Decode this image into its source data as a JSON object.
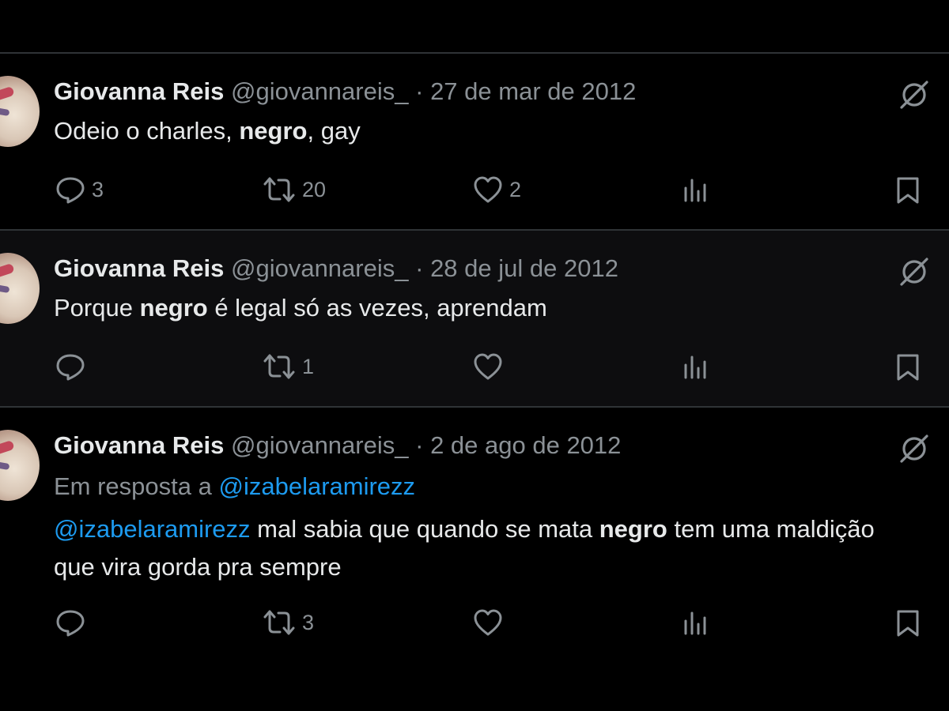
{
  "tweets": [
    {
      "name": "Giovanna Reis",
      "handle": "@giovannareis_",
      "dot": "·",
      "date": "27 de mar de 2012",
      "text": {
        "a": "Odeio o charles, ",
        "b": "negro",
        "c": ", gay"
      },
      "reply_count": "3",
      "retweet_count": "20",
      "like_count": "2"
    },
    {
      "name": "Giovanna Reis",
      "handle": "@giovannareis_",
      "dot": "·",
      "date": "28 de jul de 2012",
      "text": {
        "a": "Porque ",
        "b": "negro",
        "c": " é legal só as vezes, aprendam"
      },
      "reply_count": "",
      "retweet_count": "1",
      "like_count": ""
    },
    {
      "name": "Giovanna Reis",
      "handle": "@giovannareis_",
      "dot": "·",
      "date": "2 de ago de 2012",
      "reply_to": {
        "prefix": "Em resposta a ",
        "mention": "@izabelaramirezz"
      },
      "text": {
        "mention": "@izabelaramirezz",
        "a": " mal sabia que quando se mata ",
        "b": "negro",
        "c": " tem uma maldição",
        "line2": "que vira gorda pra sempre"
      },
      "reply_count": "",
      "retweet_count": "3",
      "like_count": ""
    }
  ],
  "icons": [
    "reply-icon",
    "retweet-icon",
    "like-icon",
    "views-icon",
    "bookmark-icon",
    "grok-icon"
  ],
  "colors": {
    "background": "#000000",
    "text": "#e7e9ea",
    "muted": "#8b9196",
    "link": "#1d9bf0",
    "divider": "#2f3336"
  }
}
